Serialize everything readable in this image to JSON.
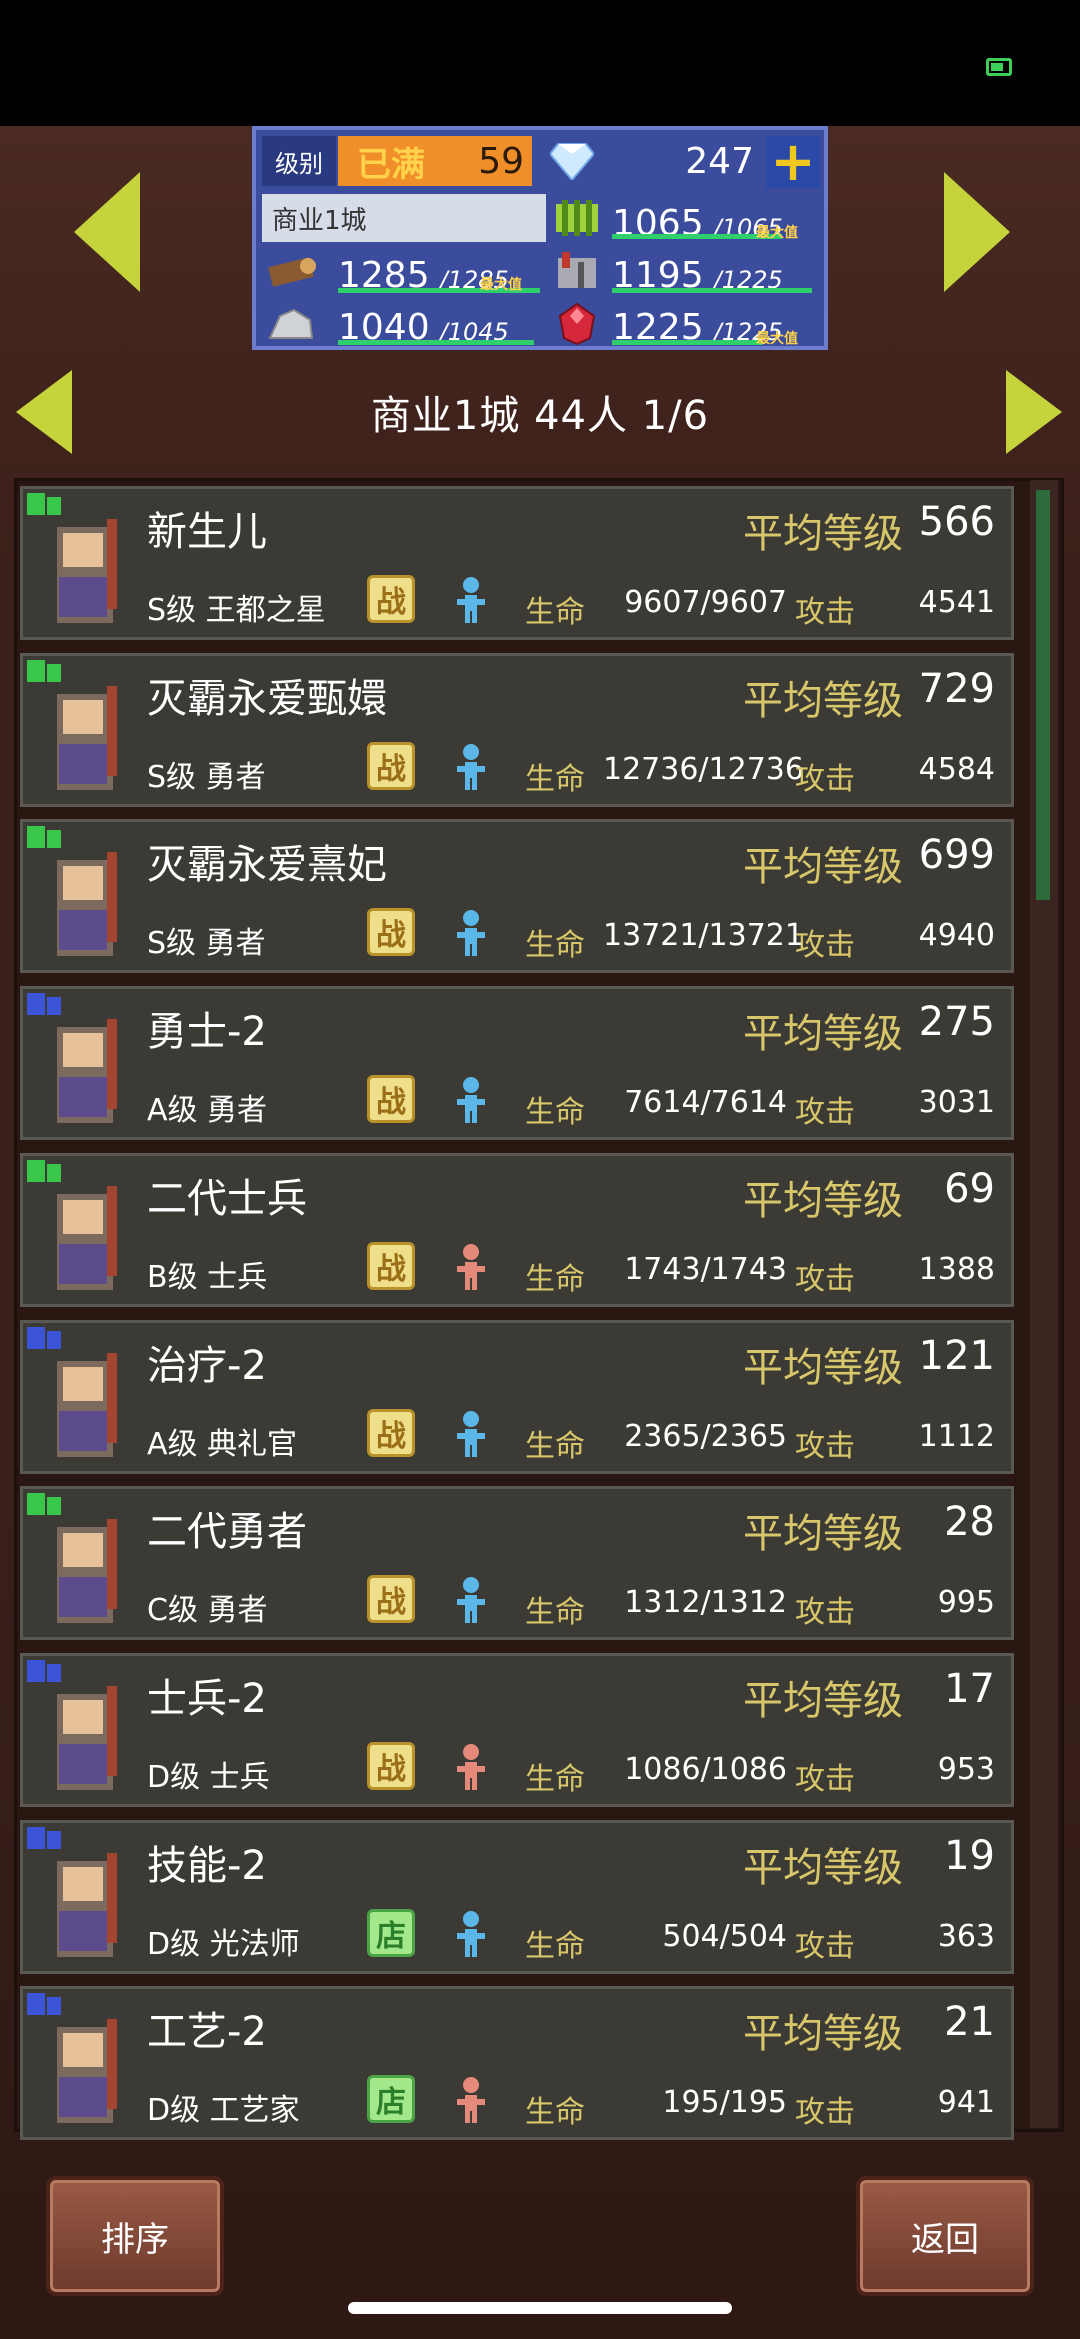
{
  "header": {
    "level_label": "级别",
    "level_status": "已满",
    "level_value": "59",
    "gems": "247",
    "plus_symbol": "+",
    "city_name": "商业1城",
    "resources": [
      {
        "name": "food",
        "icon": "wheat-icon",
        "value": "1065",
        "max": "/1065",
        "max_tag": "最大值",
        "fill": 1.0
      },
      {
        "name": "wood",
        "icon": "log-icon",
        "value": "1285",
        "max": "/1285",
        "max_tag": "最大值",
        "fill": 1.0
      },
      {
        "name": "weapons",
        "icon": "armory-icon",
        "value": "1195",
        "max": "/1225",
        "max_tag": "",
        "fill": 0.976
      },
      {
        "name": "stone",
        "icon": "ore-icon",
        "value": "1040",
        "max": "/1045",
        "max_tag": "",
        "fill": 0.995
      },
      {
        "name": "ruby",
        "icon": "ruby-icon",
        "value": "1225",
        "max": "/1225",
        "max_tag": "最大值",
        "fill": 1.0
      }
    ]
  },
  "city_header": "商业1城  44人 1/6",
  "labels": {
    "avg_level": "平均等级",
    "hp": "生命",
    "atk": "攻击"
  },
  "rows": [
    {
      "name": "新生儿",
      "level": "566",
      "cls": "S级 王都之星",
      "badge": "战",
      "badge_type": "battle",
      "gender": "male",
      "hp": "9607/9607",
      "atk": "4541",
      "rank_icon": "green-rank-icon"
    },
    {
      "name": "灭霸永爱甄嬛",
      "level": "729",
      "cls": "S级 勇者",
      "badge": "战",
      "badge_type": "battle",
      "gender": "male",
      "hp": "12736/12736",
      "atk": "4584",
      "rank_icon": "green-rank-icon"
    },
    {
      "name": "灭霸永爱熹妃",
      "level": "699",
      "cls": "S级 勇者",
      "badge": "战",
      "badge_type": "battle",
      "gender": "male",
      "hp": "13721/13721",
      "atk": "4940",
      "rank_icon": "green-rank-icon"
    },
    {
      "name": "勇士-2",
      "level": "275",
      "cls": "A级 勇者",
      "badge": "战",
      "badge_type": "battle",
      "gender": "male",
      "hp": "7614/7614",
      "atk": "3031",
      "rank_icon": "blue-rank-icon"
    },
    {
      "name": "二代士兵",
      "level": "69",
      "cls": "B级 士兵",
      "badge": "战",
      "badge_type": "battle",
      "gender": "female",
      "hp": "1743/1743",
      "atk": "1388",
      "rank_icon": "green-rank-icon"
    },
    {
      "name": "治疗-2",
      "level": "121",
      "cls": "A级 典礼官",
      "badge": "战",
      "badge_type": "battle",
      "gender": "male",
      "hp": "2365/2365",
      "atk": "1112",
      "rank_icon": "blue-rank-icon"
    },
    {
      "name": "二代勇者",
      "level": "28",
      "cls": "C级 勇者",
      "badge": "战",
      "badge_type": "battle",
      "gender": "male",
      "hp": "1312/1312",
      "atk": "995",
      "rank_icon": "green-rank-icon"
    },
    {
      "name": "士兵-2",
      "level": "17",
      "cls": "D级 士兵",
      "badge": "战",
      "badge_type": "battle",
      "gender": "female",
      "hp": "1086/1086",
      "atk": "953",
      "rank_icon": "blue-rank-icon"
    },
    {
      "name": "技能-2",
      "level": "19",
      "cls": "D级 光法师",
      "badge": "店",
      "badge_type": "shop",
      "gender": "male",
      "hp": "504/504",
      "atk": "363",
      "rank_icon": "blue-rank-icon"
    },
    {
      "name": "工艺-2",
      "level": "21",
      "cls": "D级 工艺家",
      "badge": "店",
      "badge_type": "shop",
      "gender": "female",
      "hp": "195/195",
      "atk": "941",
      "rank_icon": "blue-rank-icon"
    }
  ],
  "buttons": {
    "sort": "排序",
    "back": "返回"
  },
  "colors": {
    "accent_yellow": "#c5d43b",
    "label_gold": "#d8c76a",
    "bar_green": "#2fd06b"
  }
}
